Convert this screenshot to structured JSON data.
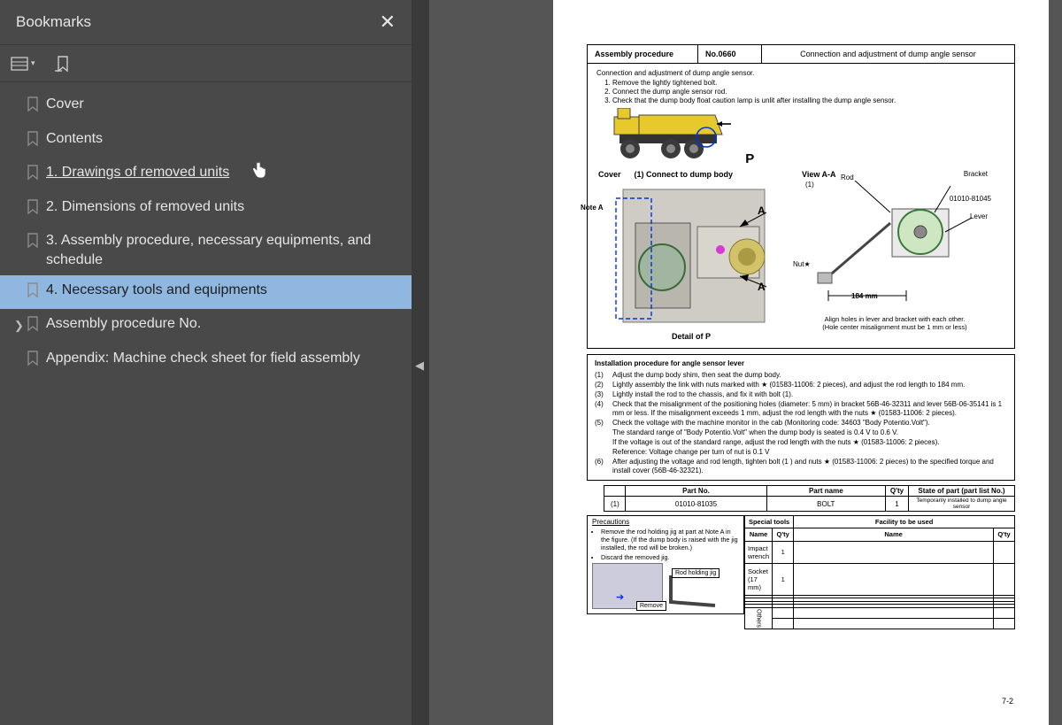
{
  "sidebar": {
    "title": "Bookmarks",
    "items": [
      {
        "label": "Cover",
        "expandable": false,
        "selected": false,
        "hovered": false
      },
      {
        "label": "Contents",
        "expandable": false,
        "selected": false,
        "hovered": false
      },
      {
        "label": "1. Drawings of removed units",
        "expandable": false,
        "selected": false,
        "hovered": true
      },
      {
        "label": "2. Dimensions of removed units",
        "expandable": false,
        "selected": false,
        "hovered": false
      },
      {
        "label": "3. Assembly procedure, necessary equipments, and schedule",
        "expandable": false,
        "selected": false,
        "hovered": false
      },
      {
        "label": "4. Necessary tools and equipments",
        "expandable": false,
        "selected": true,
        "hovered": false
      },
      {
        "label": "Assembly procedure No.",
        "expandable": true,
        "selected": false,
        "hovered": false
      },
      {
        "label": "Appendix: Machine check sheet for field assembly",
        "expandable": false,
        "selected": false,
        "hovered": false
      }
    ]
  },
  "doc": {
    "header": {
      "col1": "Assembly procedure",
      "col2": "No.0660",
      "col3": "Connection and adjustment of dump angle sensor"
    },
    "intro_title": "Connection and adjustment of dump angle sensor.",
    "intro_items": [
      "Remove the lightly tightened bolt.",
      "Connect the dump angle sensor rod.",
      "Check that the dump body float caution lamp is unlit after installing the dump angle sensor."
    ],
    "p_label": "P",
    "fig_left_connect": "(1) Connect to dump body",
    "fig_left_cover": "Cover",
    "view_label": "View A-A",
    "callouts": {
      "bracket": "Bracket",
      "rod": "Rod",
      "partno_callout": "01010-81045",
      "lever": "Lever",
      "nut": "Nut★",
      "len": "184 mm",
      "one": "(1)"
    },
    "align_l1": "Align holes in lever and bracket with each other.",
    "align_l2": "(Hole center misalignment must be 1 mm or less)",
    "note_a": "Note A",
    "detail_p": "Detail of P",
    "install_title": "Installation procedure for angle sensor lever",
    "steps": [
      {
        "n": "(1)",
        "t": "Adjust the dump body shim, then seat the dump body."
      },
      {
        "n": "(2)",
        "t": "Lightly assembly the link with nuts marked with ★ (01583-11006: 2 pieces), and adjust the rod length to 184 mm."
      },
      {
        "n": "(3)",
        "t": "Lightly install the rod to the chassis, and fix it with bolt (1)."
      },
      {
        "n": "(4)",
        "t": "Check that the misalignment of the positioning holes (diameter: 5 mm) in bracket 56B-46-32311 and lever 56B-06-35141 is 1 mm or less. If the misalignment exceeds 1 mm, adjust the rod length with the nuts ★ (01583-11006: 2 pieces)."
      },
      {
        "n": "(5)",
        "t": "Check the voltage with the machine monitor in the cab (Monitoring code: 34603 \"Body Potentio.Volt\")."
      }
    ],
    "subs": [
      "The standard range of \"Body Potentio.Volt\" when the dump body is seated is 0.4 V to 0.6 V.",
      "If the voltage is out of the standard range, adjust the rod length with the nuts ★ (01583-11006: 2 pieces).",
      "Reference: Voltage change per turn of nut is 0.1 V"
    ],
    "step6": {
      "n": "(6)",
      "t": "After adjusting the voltage and rod length, tighten bolt (1 ) and nuts ★ (01583-11006: 2 pieces) to the specified torque and install cover (56B-46-32321)."
    },
    "parts_hdr": {
      "no": "Part No.",
      "name": "Part name",
      "qty": "Q'ty",
      "sop": "State of part (part list No.)"
    },
    "parts_row": {
      "idx": "(1)",
      "no": "01010-81035",
      "name": "BOLT",
      "qty": "1",
      "sop": "Temporarily installed to dump angle sensor"
    },
    "precautions_label": "Precautions",
    "precautions": [
      "Remove the rod holding jig at part at Note A in the figure. (If the dump body is raised with the jig installed, the rod will be broken.)",
      "Discard the removed jig."
    ],
    "tools_hdr": {
      "special": "Special tools",
      "facility": "Facility to be used",
      "name": "Name",
      "qty": "Q'ty"
    },
    "tool_rows": [
      {
        "name": "Impact wrench",
        "qty": "1"
      },
      {
        "name": "Socket (17 mm)",
        "qty": "1"
      }
    ],
    "rod_jig": "Rod holding jig",
    "remove": "Remove",
    "others": "Others",
    "page_num": "7-2"
  }
}
